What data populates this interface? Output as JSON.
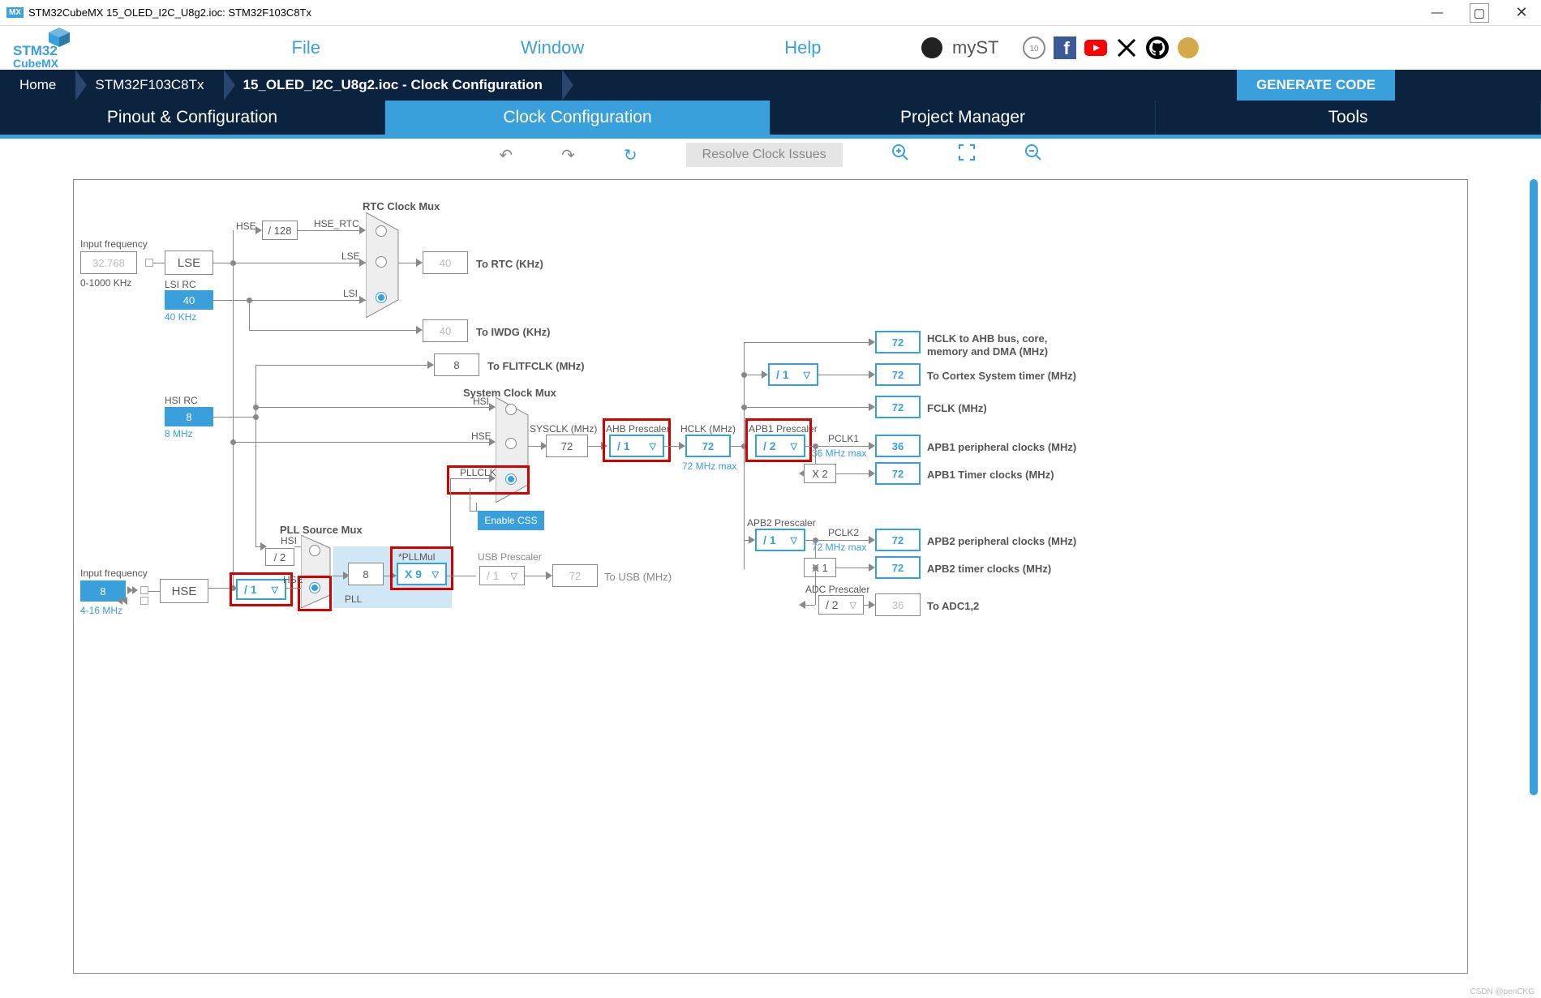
{
  "window": {
    "mx_badge": "MX",
    "title": "STM32CubeMX 15_OLED_I2C_U8g2.ioc: STM32F103C8Tx"
  },
  "brand": {
    "line1": "STM32",
    "line2": "CubeMX"
  },
  "menu": {
    "file": "File",
    "window": "Window",
    "help": "Help",
    "myst": "myST"
  },
  "breadcrumb": {
    "home": "Home",
    "device": "STM32F103C8Tx",
    "file": "15_OLED_I2C_U8g2.ioc - Clock Configuration",
    "generate": "GENERATE CODE"
  },
  "tabs": {
    "pinout": "Pinout & Configuration",
    "clock": "Clock Configuration",
    "project": "Project Manager",
    "tools": "Tools"
  },
  "toolbar": {
    "resolve": "Resolve Clock Issues"
  },
  "diagram": {
    "input_freq_label": "Input frequency",
    "lse_val": "32.768",
    "lse_range": "0-1000 KHz",
    "lse_box": "LSE",
    "lsi_rc_label": "LSI RC",
    "lsi_val": "40",
    "lsi_khz": "40 KHz",
    "hse_label": "HSE",
    "div128": "/ 128",
    "hse_rtc": "HSE_RTC",
    "lse_pin": "LSE",
    "lsi_pin": "LSI",
    "rtc_mux": "RTC Clock Mux",
    "to_rtc_val": "40",
    "to_rtc": "To RTC (KHz)",
    "to_iwdg_val": "40",
    "to_iwdg": "To IWDG (KHz)",
    "hsi_rc_label": "HSI RC",
    "hsi_val": "8",
    "hsi_mhz": "8 MHz",
    "flitfclk_val": "8",
    "to_flitfclk": "To FLITFCLK (MHz)",
    "sys_mux": "System Clock Mux",
    "hsi": "HSI",
    "hse": "HSE",
    "pllclk": "PLLCLK",
    "enable_css": "Enable CSS",
    "sysclk_label": "SYSCLK (MHz)",
    "sysclk_val": "72",
    "ahb_presc": "AHB Prescaler",
    "ahb_val": "/ 1",
    "hclk_label": "HCLK (MHz)",
    "hclk_val": "72",
    "hclk_max": "72 MHz max",
    "apb1_presc": "APB1 Prescaler",
    "apb1_val": "/ 2",
    "pclk1_label": "PCLK1",
    "pclk1_max": "36 MHz max",
    "x2": "X 2",
    "hclk_bus_val": "72",
    "hclk_bus": "HCLK to AHB bus, core, memory and DMA (MHz)",
    "cortex_div": "/ 1",
    "cortex_val": "72",
    "cortex": "To Cortex System timer (MHz)",
    "fclk_val": "72",
    "fclk": "FCLK (MHz)",
    "apb1_periph_val": "36",
    "apb1_periph": "APB1 peripheral clocks (MHz)",
    "apb1_timer_val": "72",
    "apb1_timer": "APB1 Timer clocks (MHz)",
    "apb2_presc": "APB2 Prescaler",
    "apb2_val": "/ 1",
    "pclk2_label": "PCLK2",
    "pclk2_max": "72 MHz max",
    "x1": "X 1",
    "apb2_periph_val": "72",
    "apb2_periph": "APB2 peripheral clocks (MHz)",
    "apb2_timer_val": "72",
    "apb2_timer": "APB2 timer clocks (MHz)",
    "adc_presc": "ADC Prescaler",
    "adc_val": "/ 2",
    "adc_out_val": "36",
    "adc_out": "To ADC1,2",
    "pll_src_mux": "PLL Source Mux",
    "input_freq2": "Input frequency",
    "hse_in_val": "8",
    "hse_range": "4-16 MHz",
    "div2": "/ 2",
    "hse_div": "/ 1",
    "pll_in_val": "8",
    "pll_label": "PLL",
    "pllmul_label": "*PLLMul",
    "pllmul_val": "X 9",
    "usb_presc": "USB Prescaler",
    "usb_div": "/ 1",
    "usb_val": "72",
    "to_usb": "To USB (MHz)"
  },
  "watermark": "CSDN @penCKG"
}
